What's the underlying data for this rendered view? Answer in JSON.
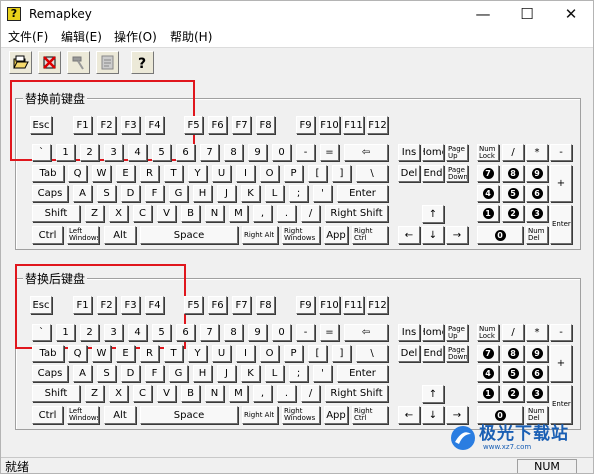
{
  "window": {
    "title": "Remapkey",
    "minimize_glyph": "—",
    "maximize_glyph": "☐",
    "close_glyph": "✕",
    "app_icon_glyph": "?"
  },
  "menu": [
    "文件(F)",
    "编辑(E)",
    "操作(O)",
    "帮助(H)"
  ],
  "toolbar": [
    {
      "icon": "open-icon"
    },
    {
      "icon": "delete-icon"
    },
    {
      "icon": "hammer-icon"
    },
    {
      "icon": "clipboard-icon"
    },
    {
      "icon": "help-icon"
    }
  ],
  "panels": [
    {
      "id": "before",
      "title": "替换前键盘"
    },
    {
      "id": "after",
      "title": "替换后键盘"
    }
  ],
  "keyboard": {
    "labels": {
      "esc": "Esc",
      "f1": "F1",
      "f2": "F2",
      "f3": "F3",
      "f4": "F4",
      "f5": "F5",
      "f6": "F6",
      "f7": "F7",
      "f8": "F8",
      "f9": "F9",
      "f10": "F10",
      "f11": "F11",
      "f12": "F12",
      "backtick": "`",
      "d1": "1",
      "d2": "2",
      "d3": "3",
      "d4": "4",
      "d5": "5",
      "d6": "6",
      "d7": "7",
      "d8": "8",
      "d9": "9",
      "d0": "0",
      "minus": "-",
      "equal": "=",
      "backspace": "⇦",
      "tab": "Tab",
      "q": "Q",
      "w": "W",
      "e": "E",
      "r": "R",
      "t": "T",
      "y": "Y",
      "u": "U",
      "i": "I",
      "o": "O",
      "p": "P",
      "lbracket": "[",
      "rbracket": "]",
      "backslash": "\\",
      "caps": "Caps",
      "a": "A",
      "s": "S",
      "d": "D",
      "f": "F",
      "g": "G",
      "h": "H",
      "j": "J",
      "k": "K",
      "l": "L",
      "semicolon": ";",
      "quote": "'",
      "enter": "Enter",
      "lshift": "Shift",
      "z": "Z",
      "x": "X",
      "c": "C",
      "v": "V",
      "b": "B",
      "n": "N",
      "m": "M",
      "comma": ",",
      "period": ".",
      "slash": "/",
      "rshift": "Right Shift",
      "lctrl": "Ctrl",
      "lwin": "Left Windows",
      "lalt": "Alt",
      "space": "Space",
      "ralt": "Right Alt",
      "rwin": "Right Windows",
      "app": "App",
      "rctrl": "Right Ctrl",
      "ins": "Ins",
      "home": "Home",
      "pgup": "Page Up",
      "del": "Del",
      "end": "End",
      "pgdn": "Page Down",
      "up": "↑",
      "left": "←",
      "down": "↓",
      "right": "→",
      "numlock": "Num Lock",
      "ndiv": "/",
      "nmul": "*",
      "nsub": "-",
      "n7": "7",
      "n8": "8",
      "n9": "9",
      "nadd": "+",
      "n4": "4",
      "n5": "5",
      "n6": "6",
      "n1": "1",
      "n2": "2",
      "n3": "3",
      "nenter": "Enter",
      "n0": "0",
      "ndel": "Num Del"
    }
  },
  "status": {
    "text": "就绪",
    "num": "NUM"
  },
  "watermark": {
    "text": "极光下载站",
    "sub": "www.xz7.com"
  }
}
